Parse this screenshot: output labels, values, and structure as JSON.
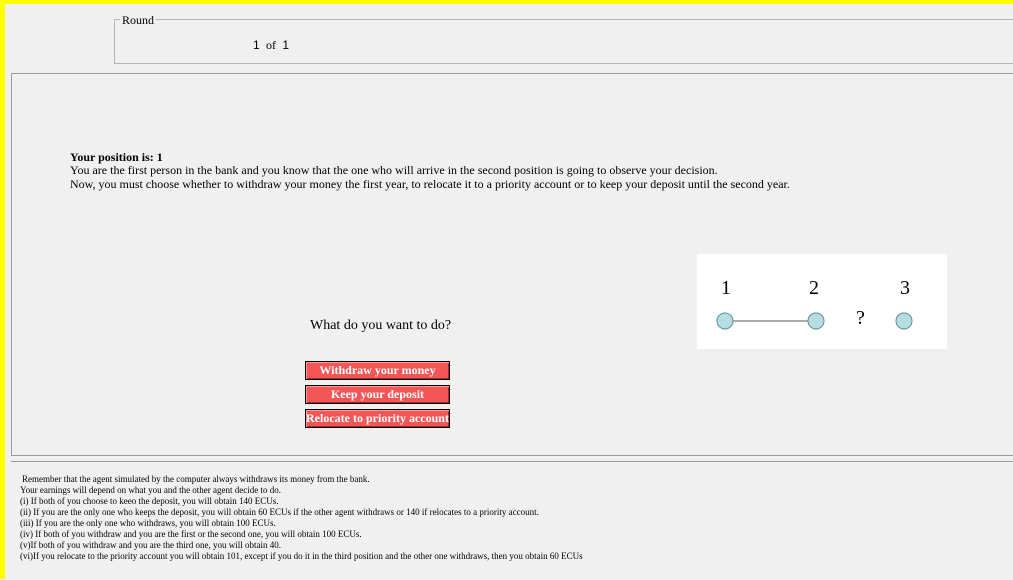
{
  "round": {
    "legend": "Round",
    "current": "1",
    "of_label": "of",
    "total": "1"
  },
  "position": {
    "title": "Your position is: 1",
    "line1": "You are the first person in the bank and you know that the one who will arrive in the second position is going to observe your decision.",
    "line2": "Now, you must choose whether to withdraw your money the first year, to relocate it to a priority account or to keep your deposit until the second year."
  },
  "question": "What do you want to do?",
  "buttons": {
    "withdraw": "Withdraw your money",
    "keep": "Keep your deposit",
    "relocate": "Relocate to priority account"
  },
  "diagram": {
    "labels": [
      "1",
      "2",
      "3"
    ],
    "question_mark": "?",
    "node_color": "#b6dde2"
  },
  "info": {
    "line0": "Remember that the agent simulated by the computer always withdraws its money from the bank.",
    "line1": " Your earnings will depend on what you and the other agent decide to do.",
    "line2": " (i) If both of you choose to keeo the deposit, you will obtain 140 ECUs.",
    "line3": "(ii) If you are the only one who keeps the deposit, you will obtain 60 ECUs if the other agent withdraws or 140 if relocates to a priority account.",
    "line4": "(iii) If you are the only one who withdraws, you will obtain 100 ECUs.",
    "line5": "(iv) If both of you withdraw and you are the first or the second one, you will obtain 100 ECUs.",
    "line6": " (v)If both of you withdraw and you are the third one, you will obtain 40.",
    "line7": " (vi)If you relocate to the priority account you will obtain 101, except if you do it in the third position and the other one withdraws, then you obtain 60 ECUs"
  },
  "colors": {
    "frame": "#ffff00",
    "button": "#f25656",
    "background": "#f0f0f0"
  }
}
